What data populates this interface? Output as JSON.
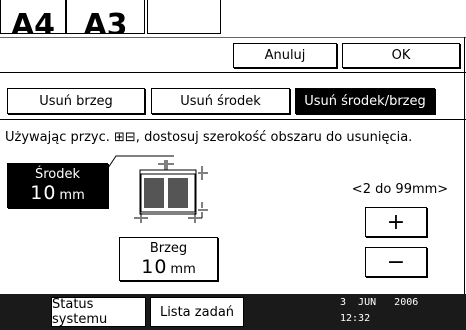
{
  "top": {
    "cell1": "A4",
    "cell2": "A3"
  },
  "actions": {
    "cancel": "Anuluj",
    "ok": "OK"
  },
  "tabs": [
    {
      "label": "Usuń brzeg",
      "selected": false
    },
    {
      "label": "Usuń środek",
      "selected": false
    },
    {
      "label": "Usuń środek/brzeg",
      "selected": true
    }
  ],
  "instruction": "Używając przyc. ⊞⊟, dostosuj szerokość obszaru do usunięcia.",
  "center": {
    "label": "Środek",
    "value": "10",
    "unit": "mm"
  },
  "edge": {
    "label": "Brzeg",
    "value": "10",
    "unit": "mm"
  },
  "range": "<2 do 99mm>",
  "plus_label": "+",
  "minus_label": "−",
  "taskbar": {
    "status": "Status systemu",
    "jobs": "Lista zadań"
  },
  "datetime": {
    "date": "3  JUN   2006",
    "time": "12:32"
  }
}
